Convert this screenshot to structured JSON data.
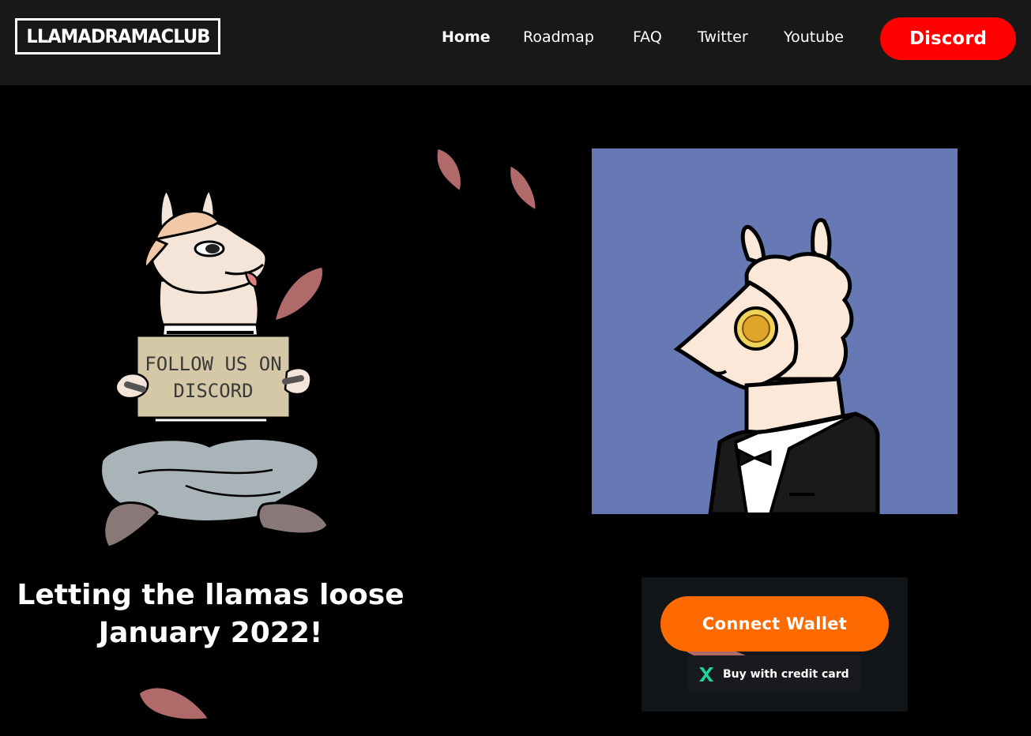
{
  "header": {
    "logo_text": "LLAMADRAMACLUB",
    "nav": [
      {
        "label": "Home",
        "active": true
      },
      {
        "label": "Roadmap",
        "active": false
      },
      {
        "label": "FAQ",
        "active": false
      },
      {
        "label": "Twitter",
        "active": false
      },
      {
        "label": "Youtube",
        "active": false
      }
    ],
    "discord_button": "Discord"
  },
  "hero": {
    "sign_line1": "FOLLOW US ON",
    "sign_line2": "DISCORD",
    "tagline_line1": "Letting the llamas loose",
    "tagline_line2": "January 2022!"
  },
  "mint": {
    "connect_wallet": "Connect Wallet",
    "credit_card": "Buy with credit card"
  },
  "colors": {
    "nav_bg": "#181818",
    "discord_red": "#ff0000",
    "connect_orange": "#ff6a00",
    "nft_bg": "#6779b5",
    "leaf": "#b06a6a"
  }
}
